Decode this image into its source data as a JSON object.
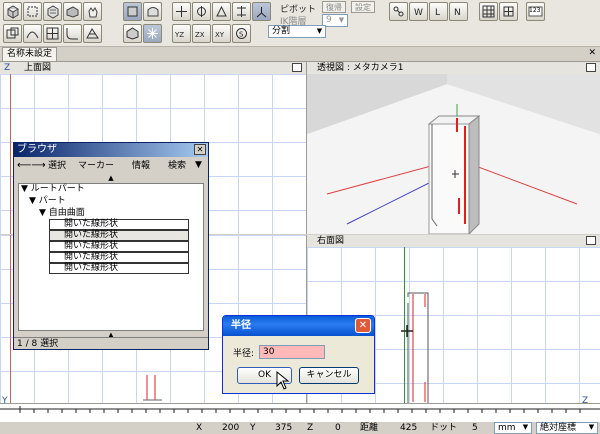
{
  "toolbar": {
    "pivot_label": "ピボット",
    "ik_label": "IK階層",
    "ik_value": "9",
    "btn_restore": "復帰",
    "btn_settings": "設定",
    "split_label": "分割",
    "numeric_icon": "123"
  },
  "document_tab": "名称未設定",
  "viewports": {
    "top": {
      "title": "上面図"
    },
    "perspective": {
      "title": "透視図 : メタカメラ1"
    },
    "right": {
      "title": "右面図"
    }
  },
  "axes": {
    "z": "Z",
    "y": "Y"
  },
  "browser": {
    "title": "ブラウザ",
    "menus": [
      "選択",
      "マーカー",
      "情報",
      "検索"
    ],
    "tree": {
      "root": "ルートパート",
      "part": "パート",
      "surface": "自由曲面",
      "items": [
        "開いた線形状",
        "開いた線形状",
        "開いた線形状",
        "開いた線形状",
        "開いた線形状"
      ]
    },
    "footer": "1 / 8 選択"
  },
  "dialog": {
    "title": "半径",
    "field_label": "半径:",
    "field_value": "30",
    "ok_label": "OK",
    "cancel_label": "キャンセル"
  },
  "status": {
    "x_label": "X",
    "x_value": "200",
    "y_label": "Y",
    "y_value": "375",
    "z_label": "Z",
    "z_value": "0",
    "distance_label": "距離",
    "distance_value": "425",
    "dots_label": "ドット",
    "dots_value": "5",
    "unit": "mm",
    "coord_mode": "絶対座標"
  },
  "colors": {
    "title_bar": "#0a246a",
    "dialog_title": "#0a5bd8",
    "input_bg": "#ffb9b9",
    "grid": "#c9d6f2",
    "axis_red": "#e02020",
    "axis_green": "#2a9a2a"
  }
}
